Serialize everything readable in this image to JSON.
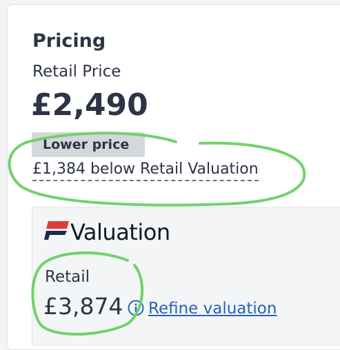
{
  "pricing": {
    "heading": "Pricing",
    "retail_label": "Retail Price",
    "price": "£2,490",
    "badge": "Lower price",
    "below_text": "£1,384 below Retail Valuation"
  },
  "valuation": {
    "title": "Valuation",
    "retail_label": "Retail",
    "retail_value": "£3,874",
    "info_icon": "info-icon",
    "refine_link": "Refine valuation"
  },
  "colors": {
    "text": "#2c3445",
    "link": "#2563b8",
    "badge_bg": "#d4d7dc",
    "annotation": "#6fd36a",
    "logo_red": "#e23a3a",
    "logo_navy": "#1e2a4a"
  }
}
